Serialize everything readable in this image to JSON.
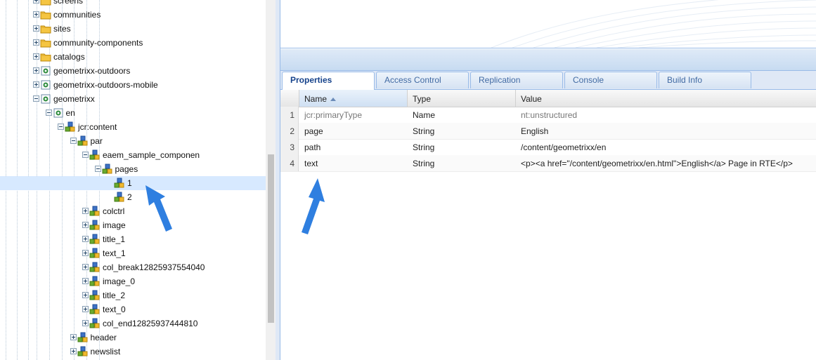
{
  "tree": {
    "nodes": [
      {
        "label": "screens",
        "icon": "folder-icon",
        "expander": "plus",
        "depth": 0
      },
      {
        "label": "communities",
        "icon": "folder-icon",
        "expander": "plus",
        "depth": 0
      },
      {
        "label": "sites",
        "icon": "folder-icon",
        "expander": "plus",
        "depth": 0
      },
      {
        "label": "community-components",
        "icon": "folder-icon",
        "expander": "plus",
        "depth": 0
      },
      {
        "label": "catalogs",
        "icon": "folder-icon",
        "expander": "plus",
        "depth": 0
      },
      {
        "label": "geometrixx-outdoors",
        "icon": "page-icon",
        "expander": "plus",
        "depth": 0
      },
      {
        "label": "geometrixx-outdoors-mobile",
        "icon": "page-icon",
        "expander": "plus",
        "depth": 0
      },
      {
        "label": "geometrixx",
        "icon": "page-icon",
        "expander": "minus",
        "depth": 0
      },
      {
        "label": "en",
        "icon": "page-icon",
        "expander": "minus",
        "depth": 1
      },
      {
        "label": "jcr:content",
        "icon": "node-icon",
        "expander": "minus",
        "depth": 2
      },
      {
        "label": "par",
        "icon": "node-icon",
        "expander": "minus",
        "depth": 3
      },
      {
        "label": "eaem_sample_componen",
        "icon": "node-icon",
        "expander": "minus",
        "depth": 4
      },
      {
        "label": "pages",
        "icon": "node-icon",
        "expander": "minus",
        "depth": 5
      },
      {
        "label": "1",
        "icon": "node-icon",
        "expander": "none",
        "depth": 6,
        "selected": true
      },
      {
        "label": "2",
        "icon": "node-icon",
        "expander": "none",
        "depth": 6
      },
      {
        "label": "colctrl",
        "icon": "node-icon",
        "expander": "plus",
        "depth": 4
      },
      {
        "label": "image",
        "icon": "node-icon",
        "expander": "plus",
        "depth": 4
      },
      {
        "label": "title_1",
        "icon": "node-icon",
        "expander": "plus",
        "depth": 4
      },
      {
        "label": "text_1",
        "icon": "node-icon",
        "expander": "plus",
        "depth": 4
      },
      {
        "label": "col_break12825937554040",
        "icon": "node-icon",
        "expander": "plus",
        "depth": 4
      },
      {
        "label": "image_0",
        "icon": "node-icon",
        "expander": "plus",
        "depth": 4
      },
      {
        "label": "title_2",
        "icon": "node-icon",
        "expander": "plus",
        "depth": 4
      },
      {
        "label": "text_0",
        "icon": "node-icon",
        "expander": "plus",
        "depth": 4
      },
      {
        "label": "col_end12825937444810",
        "icon": "node-icon",
        "expander": "plus",
        "depth": 4
      },
      {
        "label": "header",
        "icon": "node-icon",
        "expander": "plus",
        "depth": 3
      },
      {
        "label": "newslist",
        "icon": "node-icon",
        "expander": "plus",
        "depth": 3
      }
    ]
  },
  "tabs": [
    {
      "label": "Properties",
      "active": true
    },
    {
      "label": "Access Control",
      "active": false
    },
    {
      "label": "Replication",
      "active": false
    },
    {
      "label": "Console",
      "active": false
    },
    {
      "label": "Build Info",
      "active": false
    }
  ],
  "grid": {
    "columns": {
      "name": "Name",
      "type": "Type",
      "value": "Value"
    },
    "sort_column": "Name",
    "rows": [
      {
        "num": "1",
        "name": "jcr:primaryType",
        "type": "Name",
        "value": "nt:unstructured",
        "muted": true
      },
      {
        "num": "2",
        "name": "page",
        "type": "String",
        "value": "English",
        "muted": false
      },
      {
        "num": "3",
        "name": "path",
        "type": "String",
        "value": "/content/geometrixx/en",
        "muted": false
      },
      {
        "num": "4",
        "name": "text",
        "type": "String",
        "value": "<p><a href=\"/content/geometrixx/en.html\">English</a> Page in RTE</p>",
        "muted": false
      }
    ]
  },
  "annotations": [
    {
      "icon": "blue-pointer-arrow-icon",
      "color": "#2f7fe0"
    }
  ],
  "colors": {
    "selection": "#d7e9ff",
    "accent": "#15428b",
    "tab_text": "#416aa3",
    "arrow": "#2f7fe0"
  }
}
